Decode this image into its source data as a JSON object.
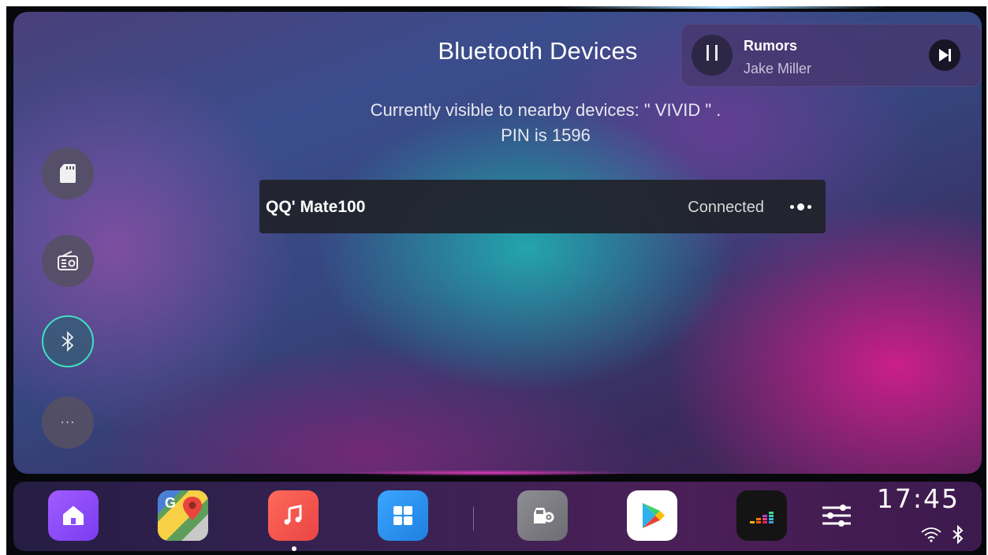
{
  "page": {
    "title": "Bluetooth Devices"
  },
  "visibility": {
    "line1": "Currently visible to nearby devices: \" VIVID \" .",
    "line2": "PIN is 1596"
  },
  "now_playing": {
    "title": "Rumors",
    "artist": "Jake Miller",
    "state": "playing"
  },
  "sidebar": {
    "items": [
      {
        "icon": "sd-card-icon",
        "active": false
      },
      {
        "icon": "radio-icon",
        "active": false
      },
      {
        "icon": "bluetooth-icon",
        "active": true
      },
      {
        "icon": "more-icon",
        "label": "···",
        "active": false
      }
    ]
  },
  "devices": [
    {
      "name": "QQ' Mate100",
      "status": "Connected"
    }
  ],
  "dock": {
    "apps": [
      {
        "icon": "home-icon",
        "color": "#8b4dff"
      },
      {
        "icon": "maps-icon",
        "color": "#3ca55c"
      },
      {
        "icon": "music-icon",
        "color": "#f0564a",
        "active": true
      },
      {
        "icon": "apps-grid-icon",
        "color": "#2b8ff0"
      },
      {
        "icon": "car-settings-icon",
        "color": "#7a7a80"
      },
      {
        "icon": "play-store-icon",
        "color": "#ffffff"
      },
      {
        "icon": "deezer-icon",
        "color": "#111111"
      },
      {
        "icon": "equalizer-settings-icon",
        "color": "#ffffff"
      }
    ]
  },
  "status": {
    "time": "17:45",
    "wifi": true,
    "bluetooth": true
  },
  "colors": {
    "accent": "#3fe0c0"
  }
}
